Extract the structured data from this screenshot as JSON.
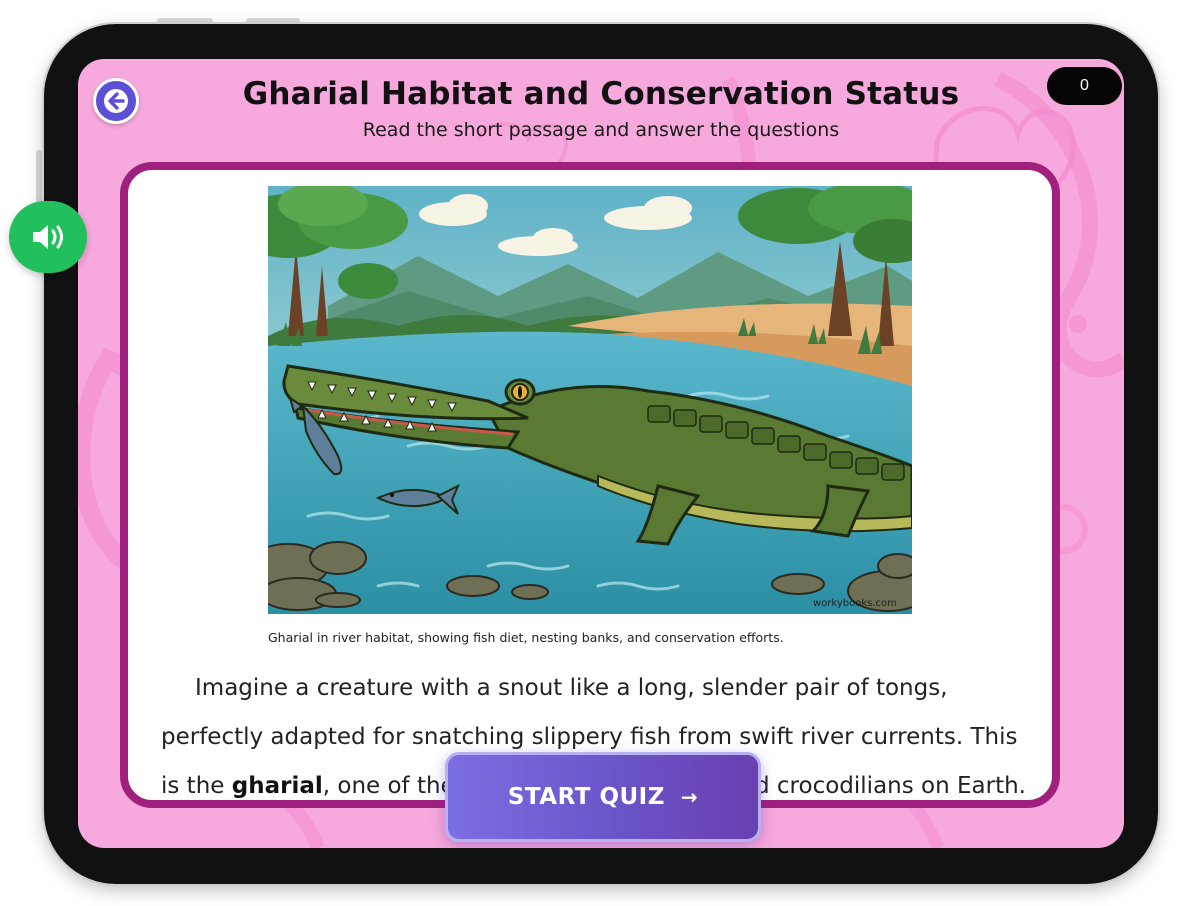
{
  "header": {
    "title": "Gharial Habitat and Conservation Status",
    "subtitle": "Read the short passage and answer the questions",
    "score": "0"
  },
  "illustration": {
    "watermark": "workybooks.com",
    "caption": "Gharial in river habitat, showing fish diet, nesting banks, and conservation efforts."
  },
  "passage": {
    "line1": "Imagine a creature with a snout like a long, slender pair of tongs,",
    "line2": "perfectly adapted for snatching slippery fish from swift river currents. This",
    "line3_pre": "is the ",
    "line3_bold": "gharial",
    "line3_post": ", one of the most critically endangered crocodilians on Earth."
  },
  "controls": {
    "start_quiz_label": "START QUIZ",
    "start_quiz_arrow": "→"
  },
  "icons": {
    "back": "arrow-left-icon",
    "audio": "speaker-icon"
  },
  "colors": {
    "background": "#f7a8dc",
    "card_border": "#a0207e",
    "back_button": "#5b4fd6",
    "audio_button": "#22c05c",
    "start_button": "#6a54c8"
  }
}
